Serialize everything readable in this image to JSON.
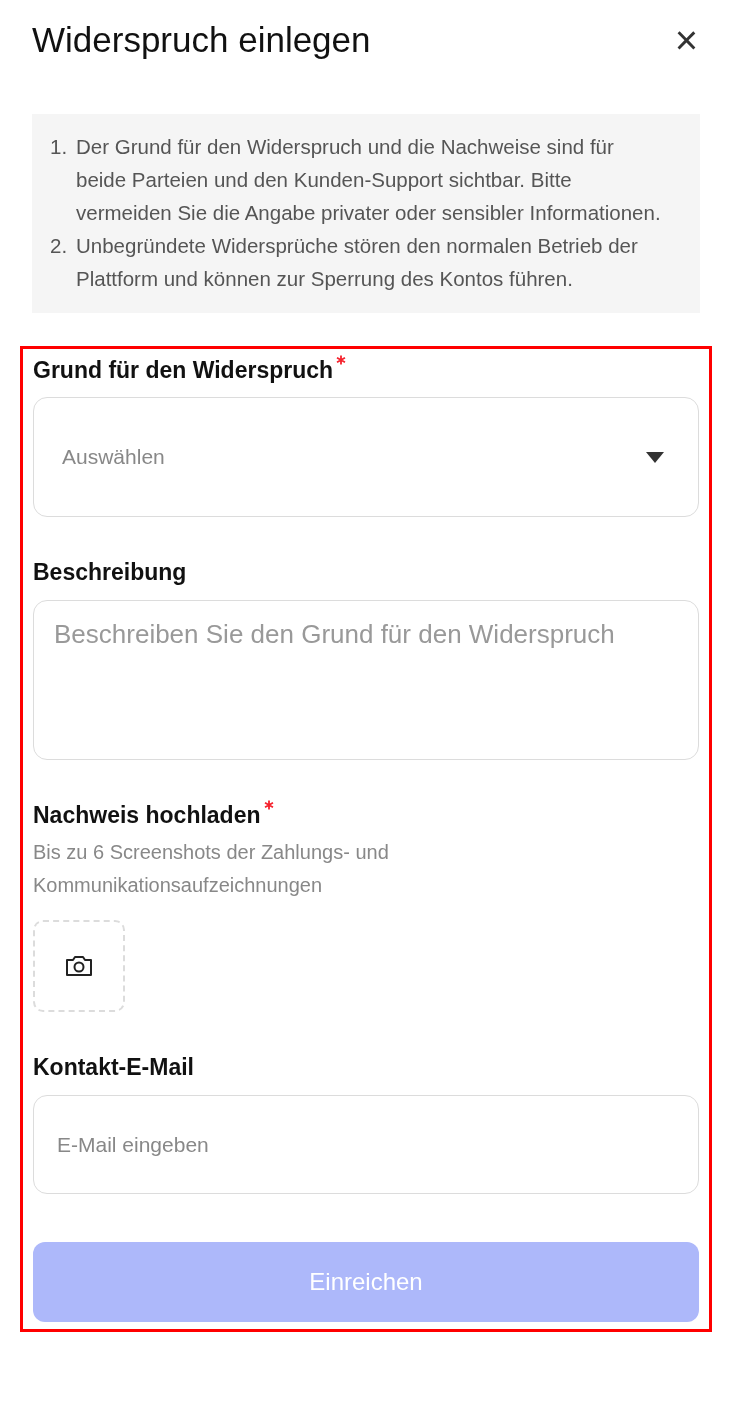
{
  "dialog": {
    "title": "Widerspruch einlegen",
    "close": "×"
  },
  "notices": [
    {
      "number": "1.",
      "text": "Der Grund für den Widerspruch und die Nachweise sind für beide Parteien und den Kunden-Support sichtbar. Bitte vermeiden Sie die Angabe privater oder sensibler Informationen."
    },
    {
      "number": "2.",
      "text": "Unbegründete Widersprüche stören den normalen Betrieb der Plattform und können zur Sperrung des Kontos führen."
    }
  ],
  "form": [
    {
      "kind": "select",
      "label": "Grund für den Widerspruch",
      "required": true,
      "placeholder": "Auswählen"
    },
    {
      "kind": "textarea",
      "label": "Beschreibung",
      "required": false,
      "placeholder": "Beschreiben Sie den Grund für den Widerspruch"
    },
    {
      "kind": "upload",
      "label": "Nachweis hochladen",
      "required": true,
      "hint": "Bis zu 6 Screenshots der Zahlungs- und Kommunikationsaufzeichnungen"
    },
    {
      "kind": "email",
      "label": "Kontakt-E-Mail",
      "required": false,
      "placeholder": "E-Mail eingeben"
    }
  ],
  "submit": {
    "label": "Einreichen",
    "disabled": true
  }
}
